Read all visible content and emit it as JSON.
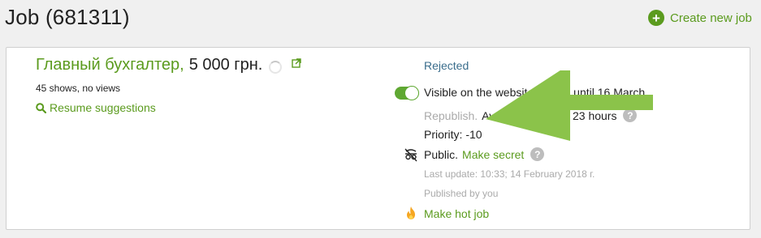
{
  "page": {
    "title": "Job (681311)",
    "create_label": "Create new job"
  },
  "job": {
    "name": "Главный бухгалтер,",
    "salary": "5 000 грн.",
    "stats": "45 shows, no views",
    "resume_suggestions": "Resume suggestions",
    "status": "Rejected"
  },
  "details": {
    "visible_label": "Visible on the website. Active until 16 March",
    "visible_on": true,
    "republish_label": "Republish.",
    "republish_note": "Available through 23 hours",
    "priority": "Priority: -10",
    "public_label": "Public.",
    "make_secret": "Make secret",
    "last_update": "Last update: 10:33; 14 February 2018 г.",
    "published_by": "Published by you",
    "make_hot": "Make hot job",
    "help_glyph": "?"
  },
  "colors": {
    "brand_green": "#5b9b1e",
    "status_blue": "#3a6d8c",
    "arrow_green": "#8bc34a"
  },
  "icons": [
    "plus-icon",
    "external-link-icon",
    "search-icon",
    "toggle-switch",
    "help-icon",
    "no-secret-icon",
    "fire-icon",
    "arrow-left-icon"
  ]
}
